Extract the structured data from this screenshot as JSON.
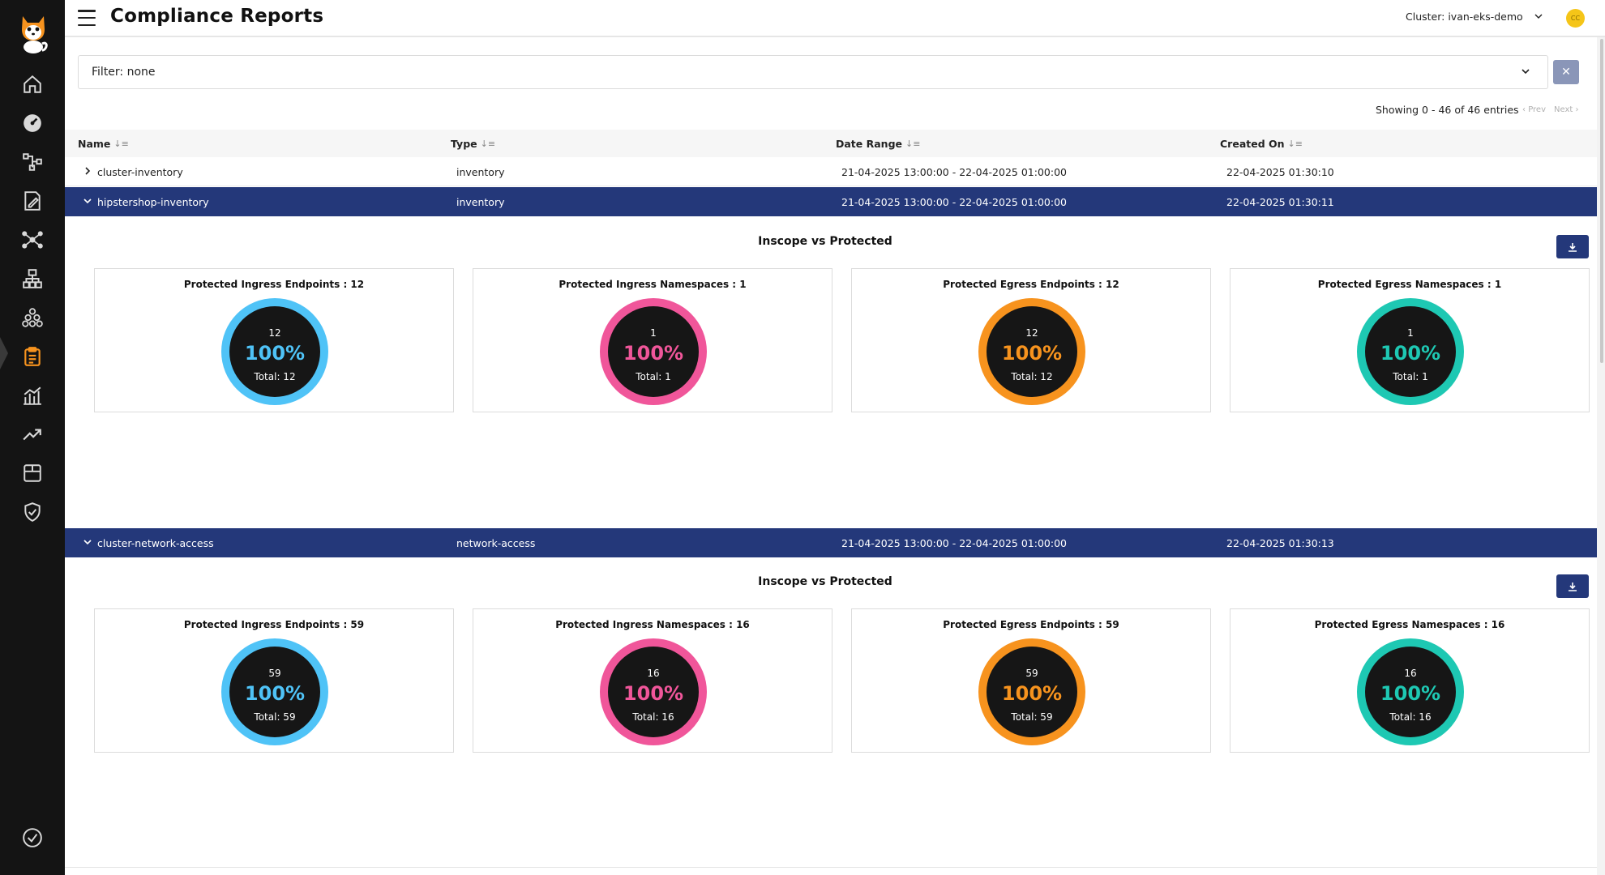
{
  "header": {
    "title": "Compliance Reports",
    "cluster_label": "Cluster: ivan-eks-demo",
    "avatar_initials": "CC"
  },
  "sidebar": {
    "items": [
      {
        "icon": "home-icon"
      },
      {
        "icon": "dashboard-gauge-icon"
      },
      {
        "icon": "topology-icon"
      },
      {
        "icon": "policy-edit-icon"
      },
      {
        "icon": "network-graph-icon"
      },
      {
        "icon": "hierarchy-icon"
      },
      {
        "icon": "cluster-nodes-icon"
      },
      {
        "icon": "compliance-clipboard-icon",
        "active": true
      },
      {
        "icon": "bar-chart-icon"
      },
      {
        "icon": "trend-icon"
      },
      {
        "icon": "store-icon"
      },
      {
        "icon": "shield-check-icon"
      }
    ],
    "footer_icon": "check-circle-icon",
    "active_color": "#f7931e"
  },
  "filter": {
    "value": "Filter: none",
    "clear_label": "✕"
  },
  "pagination": {
    "summary": "Showing 0 - 46 of 46 entries",
    "prev": "Prev",
    "next": "Next"
  },
  "table": {
    "columns": [
      "Name",
      "Type",
      "Date Range",
      "Created On"
    ],
    "rows": [
      {
        "name": "cluster-inventory",
        "type": "inventory",
        "date_range": "21-04-2025 13:00:00 - 22-04-2025 01:00:00",
        "created_on": "22-04-2025 01:30:10",
        "expanded": false
      },
      {
        "name": "hipstershop-inventory",
        "type": "inventory",
        "date_range": "21-04-2025 13:00:00 - 22-04-2025 01:00:00",
        "created_on": "22-04-2025 01:30:11",
        "expanded": true
      },
      {
        "name": "cluster-network-access",
        "type": "network-access",
        "date_range": "21-04-2025 13:00:00 - 22-04-2025 01:00:00",
        "created_on": "22-04-2025 01:30:13",
        "expanded": true
      }
    ]
  },
  "panels": [
    {
      "title": "Inscope vs Protected",
      "cards": [
        {
          "title": "Protected Ingress Endpoints : 12",
          "count": "12",
          "percent": "100%",
          "total": "Total: 12",
          "color": "#4fc3f7"
        },
        {
          "title": "Protected Ingress Namespaces : 1",
          "count": "1",
          "percent": "100%",
          "total": "Total: 1",
          "color": "#f0569a"
        },
        {
          "title": "Protected Egress Endpoints : 12",
          "count": "12",
          "percent": "100%",
          "total": "Total: 12",
          "color": "#f7931e"
        },
        {
          "title": "Protected Egress Namespaces : 1",
          "count": "1",
          "percent": "100%",
          "total": "Total: 1",
          "color": "#1ec8b3"
        }
      ]
    },
    {
      "title": "Inscope vs Protected",
      "cards": [
        {
          "title": "Protected Ingress Endpoints : 59",
          "count": "59",
          "percent": "100%",
          "total": "Total: 59",
          "color": "#4fc3f7"
        },
        {
          "title": "Protected Ingress Namespaces : 16",
          "count": "16",
          "percent": "100%",
          "total": "Total: 16",
          "color": "#f0569a"
        },
        {
          "title": "Protected Egress Endpoints : 59",
          "count": "59",
          "percent": "100%",
          "total": "Total: 59",
          "color": "#f7931e"
        },
        {
          "title": "Protected Egress Namespaces : 16",
          "count": "16",
          "percent": "100%",
          "total": "Total: 16",
          "color": "#1ec8b3"
        }
      ]
    }
  ]
}
